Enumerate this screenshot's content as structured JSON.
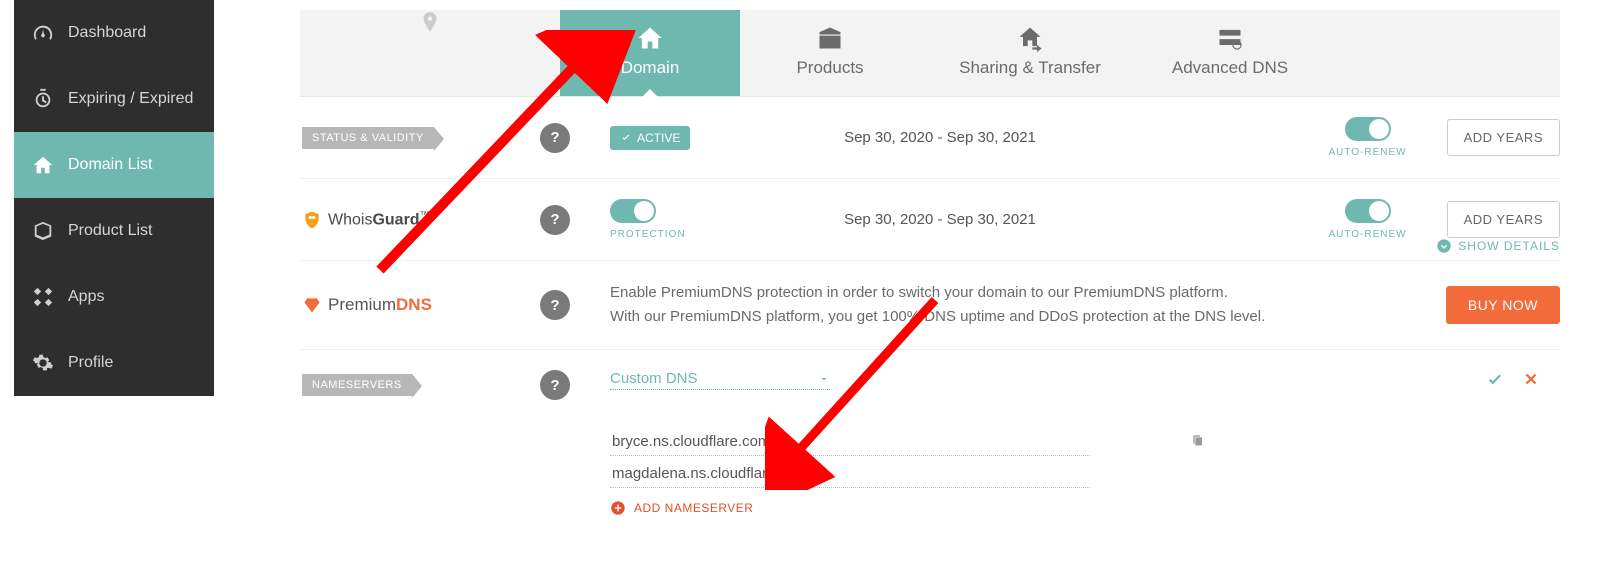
{
  "sidebar": {
    "items": [
      {
        "label": "Dashboard"
      },
      {
        "label": "Expiring / Expired"
      },
      {
        "label": "Domain List"
      },
      {
        "label": "Product List"
      },
      {
        "label": "Apps"
      },
      {
        "label": "Profile"
      }
    ]
  },
  "tabs": [
    {
      "label": "Domain"
    },
    {
      "label": "Products"
    },
    {
      "label": "Sharing & Transfer"
    },
    {
      "label": "Advanced DNS"
    }
  ],
  "status_row": {
    "tag": "STATUS & VALIDITY",
    "badge": "ACTIVE",
    "dates": "Sep 30, 2020 - Sep 30, 2021",
    "autorenew": "AUTO-RENEW",
    "button": "ADD YEARS"
  },
  "whois_row": {
    "brand_prefix": "Whois",
    "brand_suffix": "Guard",
    "dates": "Sep 30, 2020 - Sep 30, 2021",
    "protection": "PROTECTION",
    "autorenew": "AUTO-RENEW",
    "button": "ADD YEARS",
    "show_details": "SHOW DETAILS"
  },
  "premium_row": {
    "brand_prefix": "Premium",
    "brand_suffix": "DNS",
    "desc1": "Enable PremiumDNS protection in order to switch your domain to our PremiumDNS platform.",
    "desc2": "With our PremiumDNS platform, you get 100% DNS uptime and DDoS protection at the DNS level.",
    "button": "BUY NOW"
  },
  "ns_row": {
    "tag": "NAMESERVERS",
    "select": "Custom DNS",
    "ns1": "bryce.ns.cloudflare.com",
    "ns2": "magdalena.ns.cloudflare.com",
    "add": "ADD NAMESERVER"
  }
}
